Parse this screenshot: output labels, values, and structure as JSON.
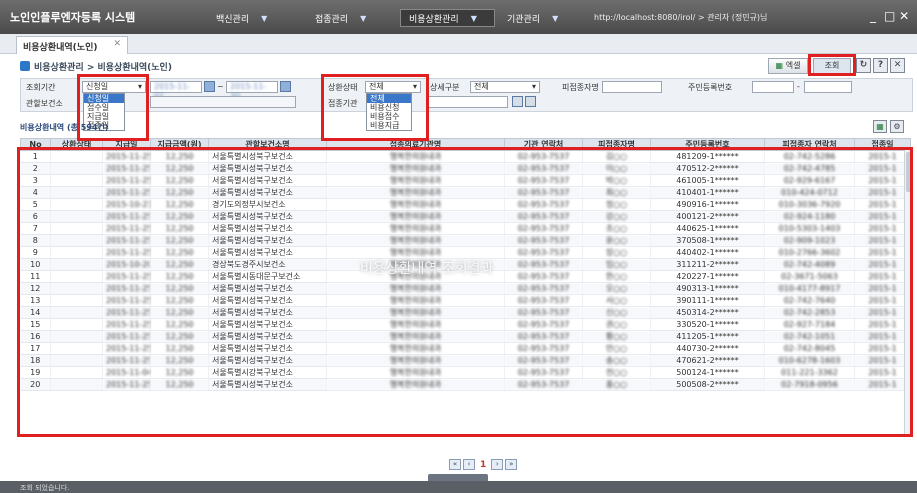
{
  "app": {
    "title": "노인인플루엔자등록 시스템"
  },
  "menu": [
    {
      "label": "백신관리"
    },
    {
      "label": "접종관리"
    },
    {
      "label": "비용상환관리"
    },
    {
      "label": "기관관리"
    }
  ],
  "address": {
    "url": "http://localhost:8080/irol/ > 관리자 (정민규)님"
  },
  "window_buttons": {
    "minimize": "_",
    "close": "□ ✕"
  },
  "tabs": [
    {
      "label": "비용상환내역(노인)",
      "close": "✕"
    }
  ],
  "breadcrumb": "비용상환관리 > 비용상환내역(노인)",
  "toolbar": {
    "excel_label": "엑셀",
    "search_label": "조회",
    "refresh": "↻",
    "help": "?",
    "close": "✕"
  },
  "search_form": {
    "period_label": "조회기간",
    "period_value": "신청일",
    "period_options": [
      "신청일",
      "접수일",
      "지급일",
      "접종일"
    ],
    "date_from": "2015-11-01",
    "date_to": "2015-11-30",
    "date_sep": "~",
    "status_label": "상환상태",
    "status_value": "전체",
    "status_options": [
      "전체",
      "비용신청",
      "비용접수",
      "비용지급"
    ],
    "detail_label": "상세구분",
    "detail_value": "전체",
    "person_label": "피접종자명",
    "rrn_label": "주민등록번호",
    "rrn_sep": "-",
    "center_label": "관할보건소",
    "org_label": "접종기관"
  },
  "grid": {
    "title": "비용상환내역 (총 594건)",
    "columns": [
      "No",
      "상환상태",
      "지급일",
      "지급금액(원)",
      "관할보건소명",
      "접종의료기관명",
      "기관 연락처",
      "피접종자명",
      "주민등록번호",
      "피접종자 연락처",
      "접종일"
    ],
    "rows": [
      {
        "no": "1",
        "status": "",
        "pay_date": "2015-11-25",
        "amount": "12,250",
        "center": "서울특별시성북구보건소",
        "org": "행복한의원내과",
        "org_tel": "02-953-7537",
        "person": "김○○",
        "rrn": "481209-1******",
        "tel": "02-742-5286",
        "date": "2015-1"
      },
      {
        "no": "2",
        "status": "",
        "pay_date": "2015-11-25",
        "amount": "12,250",
        "center": "서울특별시성북구보건소",
        "org": "행복한의원내과",
        "org_tel": "02-953-7537",
        "person": "이○○",
        "rrn": "470512-2******",
        "tel": "02-742-4785",
        "date": "2015-1"
      },
      {
        "no": "3",
        "status": "",
        "pay_date": "2015-11-25",
        "amount": "12,250",
        "center": "서울특별시성북구보건소",
        "org": "행복한의원내과",
        "org_tel": "02-953-7537",
        "person": "박○○",
        "rrn": "461005-1******",
        "tel": "02-929-6167",
        "date": "2015-1"
      },
      {
        "no": "4",
        "status": "",
        "pay_date": "2015-11-25",
        "amount": "12,250",
        "center": "서울특별시성북구보건소",
        "org": "행복한의원내과",
        "org_tel": "02-953-7537",
        "person": "최○○",
        "rrn": "410401-1******",
        "tel": "010-424-0712",
        "date": "2015-1"
      },
      {
        "no": "5",
        "status": "",
        "pay_date": "2015-10-21",
        "amount": "12,250",
        "center": "경기도의정부시보건소",
        "org": "행복한의원내과",
        "org_tel": "02-953-7537",
        "person": "정○○",
        "rrn": "490916-1******",
        "tel": "010-3036-7920",
        "date": "2015-1"
      },
      {
        "no": "6",
        "status": "",
        "pay_date": "2015-11-25",
        "amount": "12,250",
        "center": "서울특별시성북구보건소",
        "org": "행복한의원내과",
        "org_tel": "02-953-7537",
        "person": "강○○",
        "rrn": "400121-2******",
        "tel": "02-924-1180",
        "date": "2015-1"
      },
      {
        "no": "7",
        "status": "",
        "pay_date": "2015-11-25",
        "amount": "12,250",
        "center": "서울특별시성북구보건소",
        "org": "행복한의원내과",
        "org_tel": "02-953-7537",
        "person": "조○○",
        "rrn": "440625-1******",
        "tel": "010-5303-1403",
        "date": "2015-1"
      },
      {
        "no": "8",
        "status": "",
        "pay_date": "2015-11-25",
        "amount": "12,250",
        "center": "서울특별시성북구보건소",
        "org": "행복한의원내과",
        "org_tel": "02-953-7537",
        "person": "윤○○",
        "rrn": "370508-1******",
        "tel": "02-909-1023",
        "date": "2015-1"
      },
      {
        "no": "9",
        "status": "",
        "pay_date": "2015-11-25",
        "amount": "12,250",
        "center": "서울특별시성북구보건소",
        "org": "행복한의원내과",
        "org_tel": "02-953-7537",
        "person": "장○○",
        "rrn": "440402-1******",
        "tel": "010-2766-3602",
        "date": "2015-1"
      },
      {
        "no": "10",
        "status": "",
        "pay_date": "2015-10-20",
        "amount": "12,250",
        "center": "경상북도경주시보건소",
        "org": "행복한의원내과",
        "org_tel": "02-953-7537",
        "person": "임○○",
        "rrn": "311211-2******",
        "tel": "02-742-4089",
        "date": "2015-1"
      },
      {
        "no": "11",
        "status": "",
        "pay_date": "2015-11-25",
        "amount": "12,250",
        "center": "서울특별시동대문구보건소",
        "org": "행복한의원내과",
        "org_tel": "02-953-7537",
        "person": "한○○",
        "rrn": "420227-1******",
        "tel": "02-3671-5063",
        "date": "2015-1"
      },
      {
        "no": "12",
        "status": "",
        "pay_date": "2015-11-25",
        "amount": "12,250",
        "center": "서울특별시성북구보건소",
        "org": "행복한의원내과",
        "org_tel": "02-953-7537",
        "person": "오○○",
        "rrn": "490313-1******",
        "tel": "010-4177-8917",
        "date": "2015-1"
      },
      {
        "no": "13",
        "status": "",
        "pay_date": "2015-11-25",
        "amount": "12,250",
        "center": "서울특별시성북구보건소",
        "org": "행복한의원내과",
        "org_tel": "02-953-7537",
        "person": "서○○",
        "rrn": "390111-1******",
        "tel": "02-742-7640",
        "date": "2015-1"
      },
      {
        "no": "14",
        "status": "",
        "pay_date": "2015-11-25",
        "amount": "12,250",
        "center": "서울특별시성북구보건소",
        "org": "행복한의원내과",
        "org_tel": "02-953-7537",
        "person": "신○○",
        "rrn": "450314-2******",
        "tel": "02-742-2853",
        "date": "2015-1"
      },
      {
        "no": "15",
        "status": "",
        "pay_date": "2015-11-25",
        "amount": "12,250",
        "center": "서울특별시성북구보건소",
        "org": "행복한의원내과",
        "org_tel": "02-953-7537",
        "person": "권○○",
        "rrn": "330520-1******",
        "tel": "02-927-7184",
        "date": "2015-1"
      },
      {
        "no": "16",
        "status": "",
        "pay_date": "2015-11-25",
        "amount": "12,250",
        "center": "서울특별시성북구보건소",
        "org": "행복한의원내과",
        "org_tel": "02-953-7537",
        "person": "황○○",
        "rrn": "411205-1******",
        "tel": "02-742-1051",
        "date": "2015-1"
      },
      {
        "no": "17",
        "status": "",
        "pay_date": "2015-11-25",
        "amount": "12,250",
        "center": "서울특별시성북구보건소",
        "org": "행복한의원내과",
        "org_tel": "02-953-7537",
        "person": "안○○",
        "rrn": "440730-2******",
        "tel": "02-742-8045",
        "date": "2015-1"
      },
      {
        "no": "18",
        "status": "",
        "pay_date": "2015-11-25",
        "amount": "12,250",
        "center": "서울특별시성북구보건소",
        "org": "행복한의원내과",
        "org_tel": "02-953-7537",
        "person": "송○○",
        "rrn": "470621-2******",
        "tel": "010-6278-1603",
        "date": "2015-1"
      },
      {
        "no": "19",
        "status": "",
        "pay_date": "2015-11-04",
        "amount": "12,250",
        "center": "서울특별시강북구보건소",
        "org": "행복한의원내과",
        "org_tel": "02-953-7537",
        "person": "전○○",
        "rrn": "500124-1******",
        "tel": "011-221-3362",
        "date": "2015-1"
      },
      {
        "no": "20",
        "status": "",
        "pay_date": "2015-11-25",
        "amount": "12,250",
        "center": "서울특별시성북구보건소",
        "org": "행복한의원내과",
        "org_tel": "02-953-7537",
        "person": "홍○○",
        "rrn": "500508-2******",
        "tel": "02-7918-0956",
        "date": "2015-1"
      }
    ]
  },
  "overlay_text": "비용상환내역 조회결과",
  "pager": {
    "first": "«",
    "prev": "‹",
    "current": "1",
    "next": "›",
    "last": "»"
  },
  "status_text": "조회 되었습니다.",
  "colors": {
    "highlight": "#e02020",
    "titlebar": "#555555",
    "selection": "#3a77c9"
  }
}
